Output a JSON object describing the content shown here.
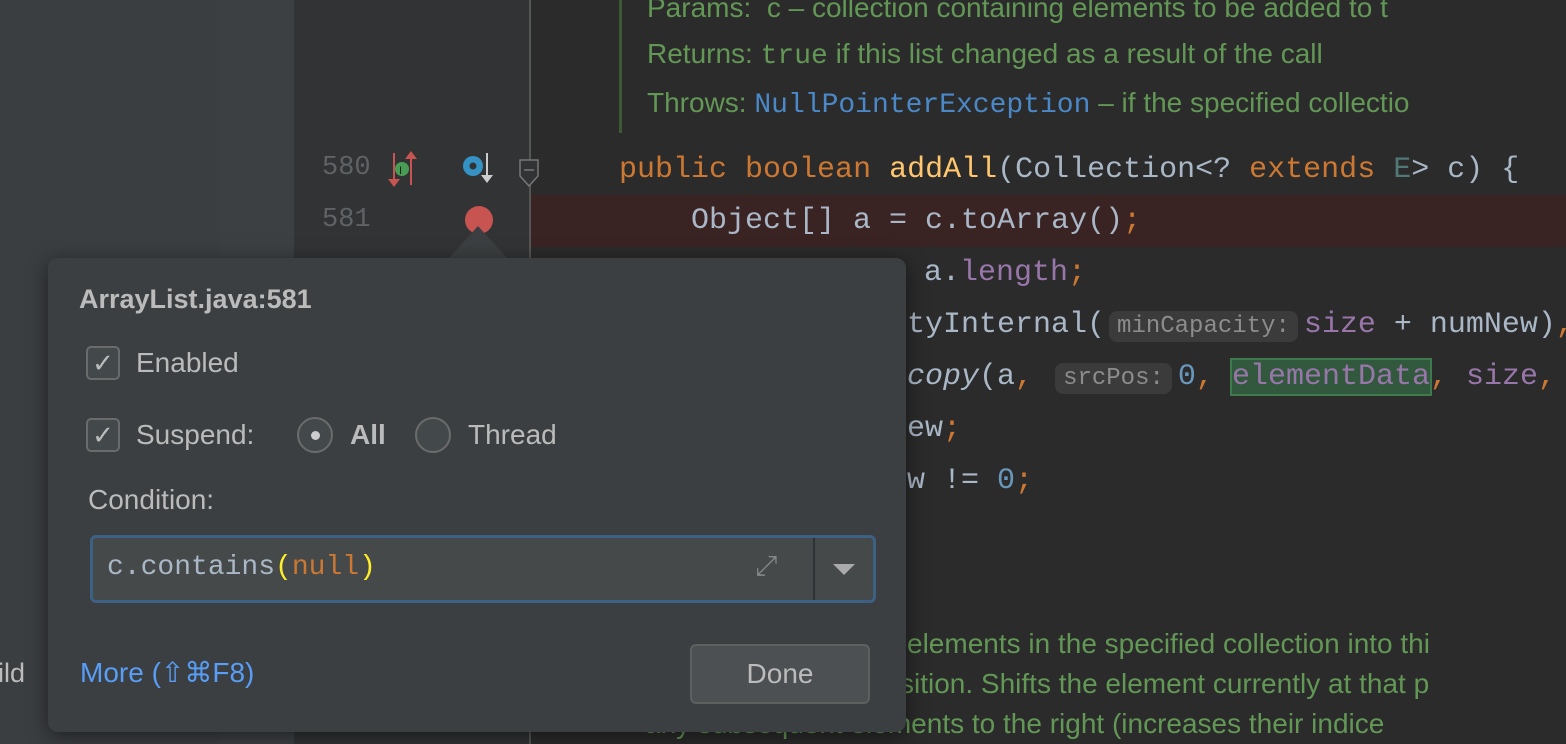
{
  "left_panel": {
    "partial_label": "ild"
  },
  "gutter": {
    "lines": [
      "580",
      "581"
    ],
    "icons": [
      "implements-overrides-icon",
      "overridden-method-icon",
      "fold-icon",
      "breakpoint-icon"
    ]
  },
  "docs_top": {
    "params_label": "Params:",
    "params_text": "c – collection containing elements to be added to t",
    "returns_label": "Returns:",
    "returns_code": "true",
    "returns_text": " if this list changed as a result of the call",
    "throws_label": "Throws:",
    "throws_link": "NullPointerException",
    "throws_text": " – if the specified collectio"
  },
  "code": {
    "l580": {
      "kw1": "public",
      "kw2": "boolean",
      "name": "addAll",
      "rest1": "(Collection<? ",
      "kw3": "extends",
      "type": "E",
      "rest2": "> c) {"
    },
    "l581": {
      "text": "    Object[] a = c.toArray()",
      "semi": ";"
    },
    "l582": {
      "a": "a.",
      "f": "length",
      "semi": ";"
    },
    "l583": {
      "a": "tyInternal(",
      "hint": "minCapacity:",
      "f": "size",
      "b": " + numNew)",
      "comma": ","
    },
    "l584": {
      "a": "copy",
      "b": "(a",
      "c1": ",",
      "hint": "srcPos:",
      "n": "0",
      "c2": ",",
      "f": "elementData",
      "c3": ",",
      "f2": "size",
      "c4": ","
    },
    "l585": {
      "a": "ew",
      "semi": ";"
    },
    "l586": {
      "a": "w != ",
      "n": "0",
      "semi": ";"
    }
  },
  "docs_bottom": [
    "elements in the specified collection into thi",
    "sition. Shifts the element currently at that p",
    "any subsequent elements to the right (increases their indice"
  ],
  "popup": {
    "title": "ArrayList.java:581",
    "enabled_label": "Enabled",
    "enabled_checked": true,
    "suspend_label": "Suspend:",
    "suspend_checked": true,
    "suspend_options": [
      "All",
      "Thread"
    ],
    "suspend_selected": "All",
    "condition_label": "Condition:",
    "condition_value": {
      "a": "c.contains",
      "p1": "(",
      "b": "null",
      "p2": ")"
    },
    "more_link": "More (⇧⌘F8)",
    "done_label": "Done"
  },
  "colors": {
    "keyword": "#cc7832",
    "method": "#ffc66d",
    "field": "#9876aa",
    "number": "#6897bb",
    "doc": "#629755",
    "link": "#589df6",
    "breakpoint": "#c75450"
  }
}
